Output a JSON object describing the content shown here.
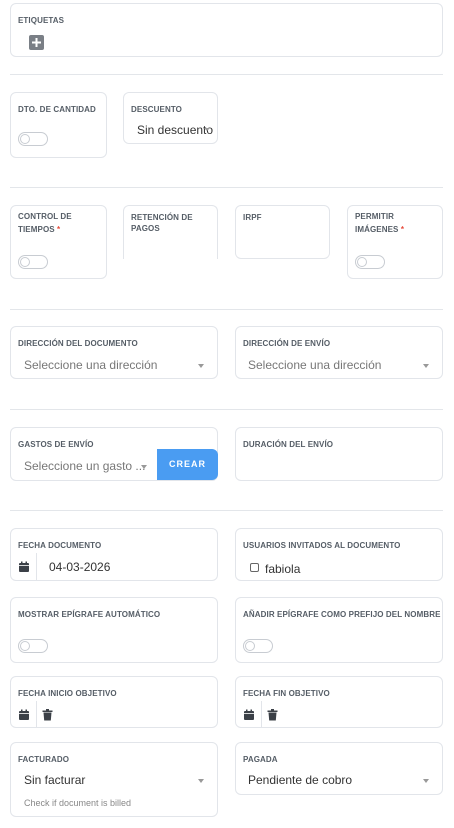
{
  "etiquetas": {
    "label": "ETIQUETAS"
  },
  "dto_cantidad": {
    "label": "DTO. DE CANTIDAD"
  },
  "descuento": {
    "label": "DESCUENTO",
    "value": "Sin descuento"
  },
  "control_tiempos": {
    "label_line1": "CONTROL DE",
    "label_line2": "TIEMPOS",
    "required": "*"
  },
  "retencion_pagos": {
    "label": "RETENCIÓN DE PAGOS"
  },
  "irpf": {
    "label": "IRPF"
  },
  "permitir_imagenes": {
    "label_line1": "PERMITIR",
    "label_line2": "IMÁGENES",
    "required": "*"
  },
  "direccion_documento": {
    "label": "DIRECCIÓN DEL DOCUMENTO",
    "placeholder": "Seleccione una dirección"
  },
  "direccion_envio": {
    "label": "DIRECCIÓN DE ENVÍO",
    "placeholder": "Seleccione una dirección"
  },
  "gastos_envio": {
    "label": "GASTOS DE ENVÍO",
    "placeholder": "Seleccione un gasto ...",
    "button": "CREAR"
  },
  "duracion_envio": {
    "label": "DURACIÓN DEL ENVÍO"
  },
  "fecha_documento": {
    "label": "FECHA DOCUMENTO",
    "value": "04-03-2026"
  },
  "usuarios_invitados": {
    "label": "USUARIOS INVITADOS AL DOCUMENTO",
    "user": "fabiola"
  },
  "mostrar_epigrafe": {
    "label": "MOSTRAR EPÍGRAFE AUTOMÁTICO"
  },
  "anadir_epigrafe": {
    "label": "AÑADIR EPÍGRAFE COMO PREFIJO DEL NOMBRE"
  },
  "fecha_inicio": {
    "label": "FECHA INICIO OBJETIVO"
  },
  "fecha_fin": {
    "label": "FECHA FIN OBJETIVO"
  },
  "facturado": {
    "label": "FACTURADO",
    "value": "Sin facturar",
    "help": "Check if document is billed"
  },
  "pagada": {
    "label": "PAGADA",
    "value": "Pendiente de cobro"
  },
  "colors": {
    "accent": "#4a9cf2",
    "required": "#e74c3c",
    "border": "#e2e5ea"
  }
}
